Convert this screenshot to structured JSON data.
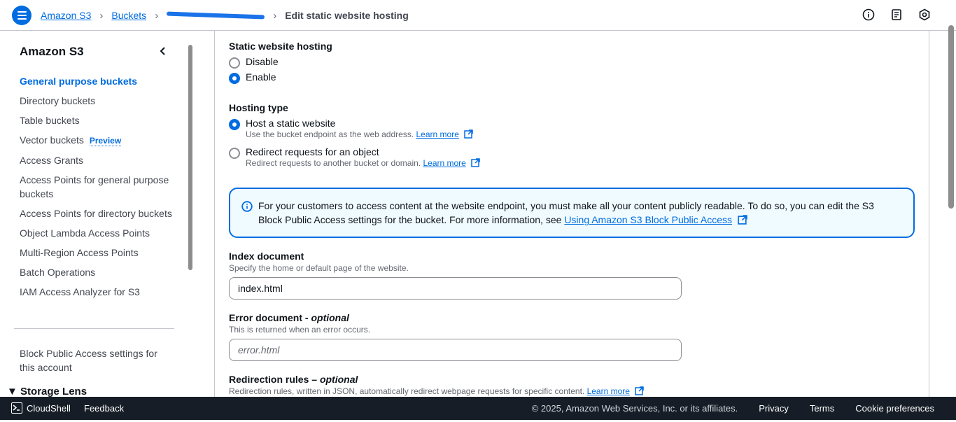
{
  "breadcrumb": {
    "root": "Amazon S3",
    "buckets": "Buckets",
    "current": "Edit static website hosting"
  },
  "top_icons": [
    "info-icon",
    "notes-icon",
    "settings-icon"
  ],
  "sidebar": {
    "title": "Amazon S3",
    "items": [
      {
        "label": "General purpose buckets"
      },
      {
        "label": "Directory buckets"
      },
      {
        "label": "Table buckets"
      },
      {
        "label": "Vector buckets",
        "badge": "Preview"
      },
      {
        "label": "Access Grants"
      },
      {
        "label": "Access Points for general purpose buckets"
      },
      {
        "label": "Access Points for directory buckets"
      },
      {
        "label": "Object Lambda Access Points"
      },
      {
        "label": "Multi-Region Access Points"
      },
      {
        "label": "Batch Operations"
      },
      {
        "label": "IAM Access Analyzer for S3"
      }
    ],
    "block_public_access": "Block Public Access settings for this account",
    "storage_lens": "Storage Lens"
  },
  "hosting": {
    "label": "Static website hosting",
    "disable": "Disable",
    "enable": "Enable",
    "selected": "Enable"
  },
  "hosting_type": {
    "label": "Hosting type",
    "host_label": "Host a static website",
    "host_desc": "Use the bucket endpoint as the web address.",
    "redirect_label": "Redirect requests for an object",
    "redirect_desc": "Redirect requests to another bucket or domain.",
    "learn_more": "Learn more",
    "selected": "Host a static website"
  },
  "info_alert": {
    "text": "For your customers to access content at the website endpoint, you must make all your content publicly readable. To do so, you can edit the S3 Block Public Access settings for the bucket. For more information, see",
    "link": "Using Amazon S3 Block Public Access"
  },
  "index_document": {
    "label": "Index document",
    "desc": "Specify the home or default page of the website.",
    "value": "index.html"
  },
  "error_document": {
    "label": "Error document",
    "optional": "optional",
    "desc": "This is returned when an error occurs.",
    "placeholder": "error.html"
  },
  "redirection_rules": {
    "label": "Redirection rules",
    "optional": "optional",
    "desc": "Redirection rules, written in JSON, automatically redirect webpage requests for specific content.",
    "learn_more": "Learn more"
  },
  "footer": {
    "cloudshell": "CloudShell",
    "feedback": "Feedback",
    "copyright": "© 2025, Amazon Web Services, Inc. or its affiliates.",
    "privacy": "Privacy",
    "terms": "Terms",
    "cookies": "Cookie preferences"
  },
  "colors": {
    "accent": "#006ce0",
    "footer_bg": "#161d26",
    "info_bg": "#f0fbff"
  }
}
